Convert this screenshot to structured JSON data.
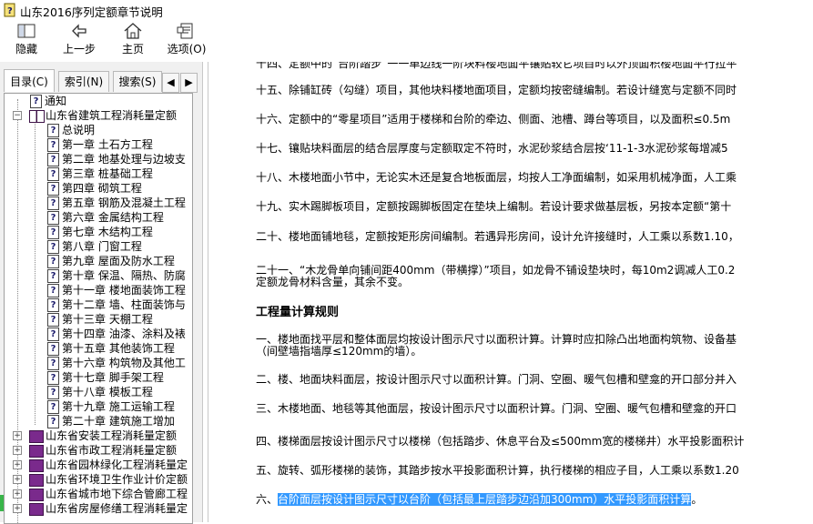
{
  "window": {
    "title": "山东2016序列定额章节说明"
  },
  "toolbar": {
    "hide_label": "隐藏",
    "back_label": "上一步",
    "home_label": "主页",
    "options_label": "选项(O)"
  },
  "tabs": {
    "contents": "目录(C)",
    "index": "索引(N)",
    "search": "搜索(S)"
  },
  "tree": {
    "notice": "通知",
    "building": "山东省建筑工程消耗量定额",
    "chapters": [
      "总说明",
      "第一章  土石方工程",
      "第二章  地基处理与边坡支",
      "第三章  桩基础工程",
      "第四章  砌筑工程",
      "第五章  钢筋及混凝土工程",
      "第六章  金属结构工程",
      "第七章  木结构工程",
      "第八章  门窗工程",
      "第九章  屋面及防水工程",
      "第十章  保温、隔热、防腐",
      "第十一章  楼地面装饰工程",
      "第十二章  墙、柱面装饰与",
      "第十三章  天棚工程",
      "第十四章  油漆、涂料及裱",
      "第十五章  其他装饰工程",
      "第十六章  构筑物及其他工",
      "第十七章  脚手架工程",
      "第十八章  模板工程",
      "第十九章  施工运输工程",
      "第二十章  建筑施工增加"
    ],
    "others": [
      "山东省安装工程消耗量定额",
      "山东省市政工程消耗量定额",
      "山东省园林绿化工程消耗量定",
      "山东省环境卫生作业计价定额",
      "山东省城市地下综合管廊工程",
      "山东省房屋修缮工程消耗量定"
    ]
  },
  "content": {
    "top_partial": "十四、定额中的“台阶踏步”一一单边线一阶块料楼地面平镶贴较它项目时以外顶面积楼地面平行拉平",
    "p15": "十五、除铺缸砖（勾缝）项目，其他块料楼地面项目，定额均按密缝编制。若设计缝宽与定额不同时",
    "p16": "十六、定额中的“零星项目”适用于楼梯和台阶的牵边、侧面、池槽、蹲台等项目，以及面积≤0.5m",
    "p17": "十七、镶贴块料面层的结合层厚度与定额取定不符时，水泥砂浆结合层按‘11-1-3水泥砂浆每增减5",
    "p18": "十八、木楼地面小节中，无论实木还是复合地板面层，均按人工净面编制，如采用机械净面，人工乘",
    "p19": "十九、实木踢脚板项目，定额按踢脚板固定在垫块上编制。若设计要求做基层板，另按本定额“第十",
    "p20": "二十、楼地面铺地毯，定额按矩形房间编制。若遇异形房间，设计允许接缝时，人工乘以系数1.10，",
    "p21_line1": "二十一、“木龙骨单向铺间距400mm（带横撑）”项目，如龙骨不铺设垫块时，每10m2调减人工0.2",
    "p21_line2": "定额龙骨材料含量，其余不变。",
    "heading": "工程量计算规则",
    "r1_line1": "一、楼地面找平层和整体面层均按设计图示尺寸以面积计算。计算时应扣除凸出地面构筑物、设备基",
    "r1_line2": "（间壁墙指墙厚≤120mm的墙）。",
    "r2": "二、楼、地面块料面层，按设计图示尺寸以面积计算。门洞、空圈、暖气包槽和壁龛的开口部分并入",
    "r3": "三、木楼地面、地毯等其他面层，按设计图示尺寸以面积计算。门洞、空圈、暖气包槽和壁龛的开口",
    "r4": "四、楼梯面层按设计图示尺寸以楼梯（包括踏步、休息平台及≤500mm宽的楼梯井）水平投影面积计",
    "r5": "五、旋转、弧形楼梯的装饰，其踏步按水平投影面积计算，执行楼梯的相应子目，人工乘以系数1.20",
    "r6_prefix": "六、",
    "r6_highlight": "台阶面层按设计图示尺寸以台阶（包括最上层踏步边沿加300mm）水平投影面积计算",
    "r6_suffix": "。"
  }
}
